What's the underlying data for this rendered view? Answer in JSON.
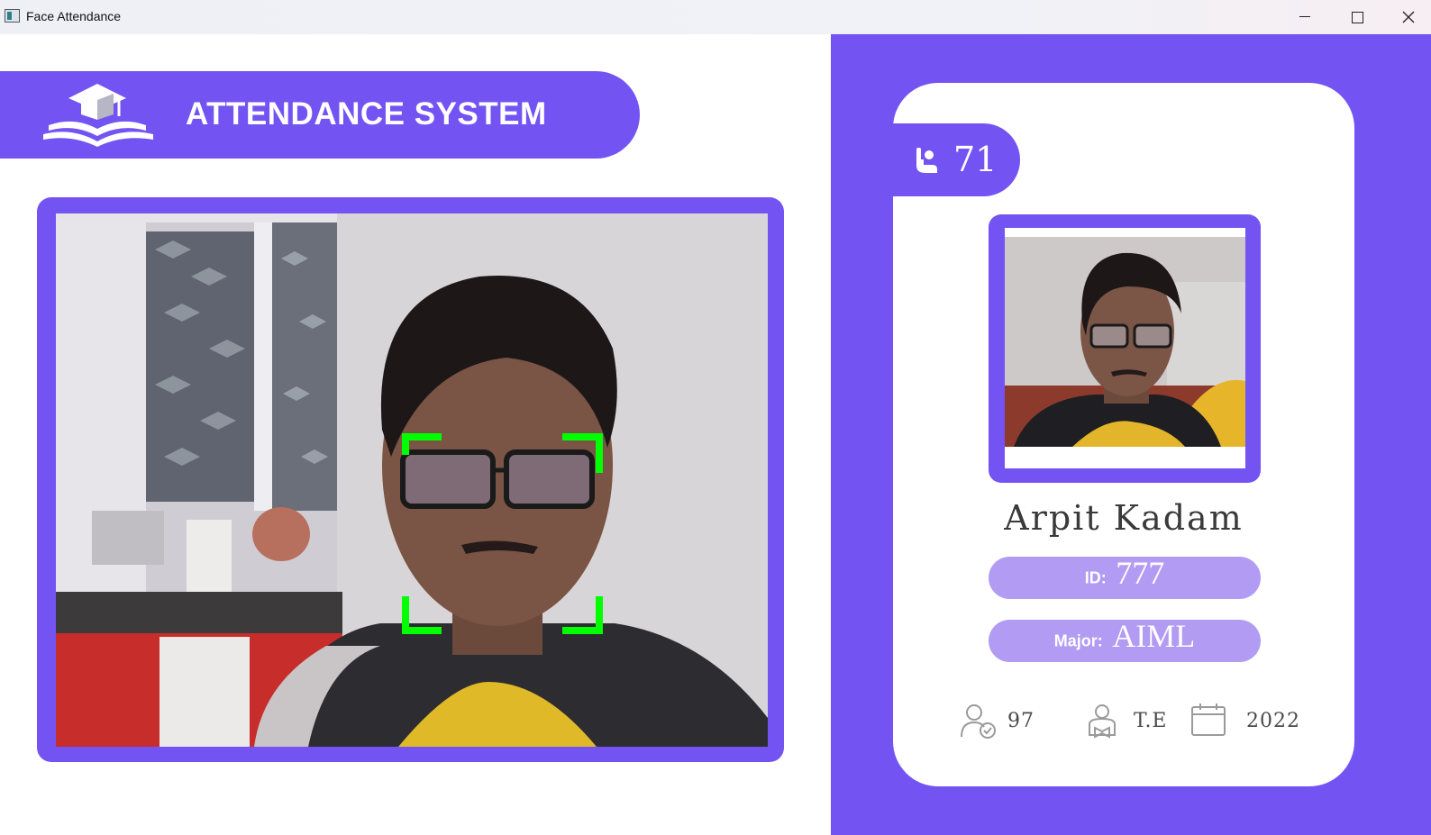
{
  "window": {
    "title": "Face Attendance",
    "controls": [
      "minimize",
      "maximize",
      "close"
    ]
  },
  "header": {
    "title": "ATTENDANCE SYSTEM",
    "logo_icon": "graduation-cap-book-icon"
  },
  "camera": {
    "feed": "live webcam view with face detection box",
    "detection_box_color": "#00ff00"
  },
  "student_card": {
    "total_attendance": "71",
    "name": "Arpit Kadam",
    "id_label": "ID:",
    "id_value": "777",
    "major_label": "Major:",
    "major_value": "AIML",
    "standing": "97",
    "year": "T.E",
    "starting_year": "2022"
  },
  "colors": {
    "accent": "#7354f3",
    "pill": "#b29bf3",
    "card": "#ffffff"
  }
}
